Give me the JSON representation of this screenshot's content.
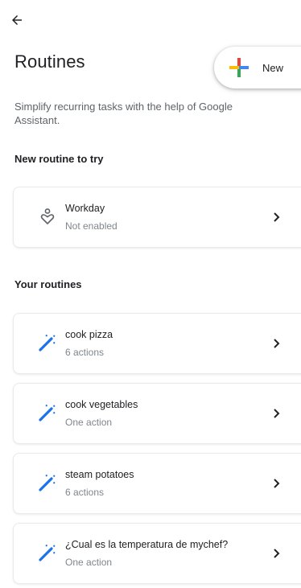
{
  "header": {
    "title": "Routines",
    "new_label": "New"
  },
  "subtitle": "Simplify recurring tasks with the help of Google Assistant.",
  "sections": {
    "try_heading": "New routine to try",
    "yours_heading": "Your routines"
  },
  "suggested": {
    "name": "Workday",
    "status": "Not enabled",
    "icon": "person-heart-icon"
  },
  "routines": [
    {
      "name": "cook pizza",
      "status": "6 actions",
      "icon": "magic-wand-icon"
    },
    {
      "name": "cook vegetables",
      "status": "One action",
      "icon": "magic-wand-icon"
    },
    {
      "name": "steam potatoes",
      "status": "6 actions",
      "icon": "magic-wand-icon"
    },
    {
      "name": "¿Cual es la temperatura de mychef?",
      "status": "One action",
      "icon": "magic-wand-icon"
    }
  ],
  "colors": {
    "google_blue": "#4285F4",
    "google_red": "#EA4335",
    "google_yellow": "#FBBC05",
    "google_green": "#34A853",
    "wand_blue": "#1A73E8"
  }
}
